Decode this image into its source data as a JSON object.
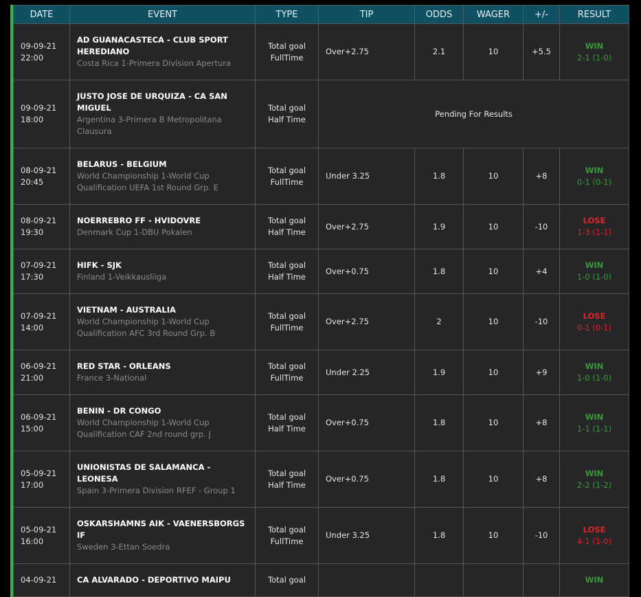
{
  "headers": [
    "DATE",
    "EVENT",
    "TYPE",
    "TIP",
    "ODDS",
    "WAGER",
    "+/-",
    "RESULT"
  ],
  "rows": [
    {
      "date": "09-09-21",
      "time": "22:00",
      "event": "AD GUANACASTECA - CLUB SPORT HEREDIANO",
      "league": "Costa Rica 1-Primera Division Apertura",
      "type1": "Total goal",
      "type2": "FullTime",
      "tip": "Over+2.75",
      "odds": "2.1",
      "wager": "10",
      "pl": "+5.5",
      "result": "WIN",
      "score": "2-1 (1-0)"
    },
    {
      "date": "09-09-21",
      "time": "18:00",
      "event": "JUSTO JOSE DE URQUIZA - CA SAN MIGUEL",
      "league": "Argentina 3-Primera B Metropolitana Clausura",
      "type1": "Total goal",
      "type2": "Half Time",
      "pending": "Pending For Results"
    },
    {
      "date": "08-09-21",
      "time": "20:45",
      "event": "BELARUS - BELGIUM",
      "league": "World Championship 1-World Cup Qualification UEFA 1st Round Grp. E",
      "type1": "Total goal",
      "type2": "FullTime",
      "tip": "Under 3.25",
      "odds": "1.8",
      "wager": "10",
      "pl": "+8",
      "result": "WIN",
      "score": "0-1 (0-1)"
    },
    {
      "date": "08-09-21",
      "time": "19:30",
      "event": "NOERREBRO FF - HVIDOVRE",
      "league": "Denmark Cup 1-DBU Pokalen",
      "type1": "Total goal",
      "type2": "Half Time",
      "tip": "Over+2.75",
      "odds": "1.9",
      "wager": "10",
      "pl": "-10",
      "result": "LOSE",
      "score": "1-3 (1-1)"
    },
    {
      "date": "07-09-21",
      "time": "17:30",
      "event": "HIFK - SJK",
      "league": "Finland 1-Veikkausliiga",
      "type1": "Total goal",
      "type2": "Half Time",
      "tip": "Over+0.75",
      "odds": "1.8",
      "wager": "10",
      "pl": "+4",
      "result": "WIN",
      "score": "1-0 (1-0)"
    },
    {
      "date": "07-09-21",
      "time": "14:00",
      "event": "VIETNAM - AUSTRALIA",
      "league": "World Championship 1-World Cup Qualification AFC 3rd Round Grp. B",
      "type1": "Total goal",
      "type2": "FullTime",
      "tip": "Over+2.75",
      "odds": "2",
      "wager": "10",
      "pl": "-10",
      "result": "LOSE",
      "score": "0-1 (0-1)"
    },
    {
      "date": "06-09-21",
      "time": "21:00",
      "event": "RED STAR - ORLEANS",
      "league": "France 3-National",
      "type1": "Total goal",
      "type2": "FullTime",
      "tip": "Under 2.25",
      "odds": "1.9",
      "wager": "10",
      "pl": "+9",
      "result": "WIN",
      "score": "1-0 (1-0)"
    },
    {
      "date": "06-09-21",
      "time": "15:00",
      "event": "BENIN - DR CONGO",
      "league": "World Championship 1-World Cup Qualification CAF 2nd round grp. J",
      "type1": "Total goal",
      "type2": "Half Time",
      "tip": "Over+0.75",
      "odds": "1.8",
      "wager": "10",
      "pl": "+8",
      "result": "WIN",
      "score": "1-1 (1-1)"
    },
    {
      "date": "05-09-21",
      "time": "17:00",
      "event": "UNIONISTAS DE SALAMANCA - LEONESA",
      "league": "Spain 3-Primera Division RFEF - Group 1",
      "type1": "Total goal",
      "type2": "Half Time",
      "tip": "Over+0.75",
      "odds": "1.8",
      "wager": "10",
      "pl": "+8",
      "result": "WIN",
      "score": "2-2 (1-2)"
    },
    {
      "date": "05-09-21",
      "time": "16:00",
      "event": "OSKARSHAMNS AIK - VAENERSBORGS IF",
      "league": "Sweden 3-Ettan Soedra",
      "type1": "Total goal",
      "type2": "FullTime",
      "tip": "Under 3.25",
      "odds": "1.8",
      "wager": "10",
      "pl": "-10",
      "result": "LOSE",
      "score": "4-1 (1-0)"
    },
    {
      "date": "04-09-21",
      "time": "",
      "event": "CA ALVARADO - DEPORTIVO MAIPU",
      "league": "",
      "type1": "Total goal",
      "type2": "",
      "tip": "",
      "odds": "",
      "wager": "",
      "pl": "",
      "result": "WIN",
      "score": ""
    }
  ],
  "colors": {
    "header": "#0f5063",
    "win": "#3a9a3a",
    "lose": "#d8262b",
    "accent": "#3cb34a"
  }
}
